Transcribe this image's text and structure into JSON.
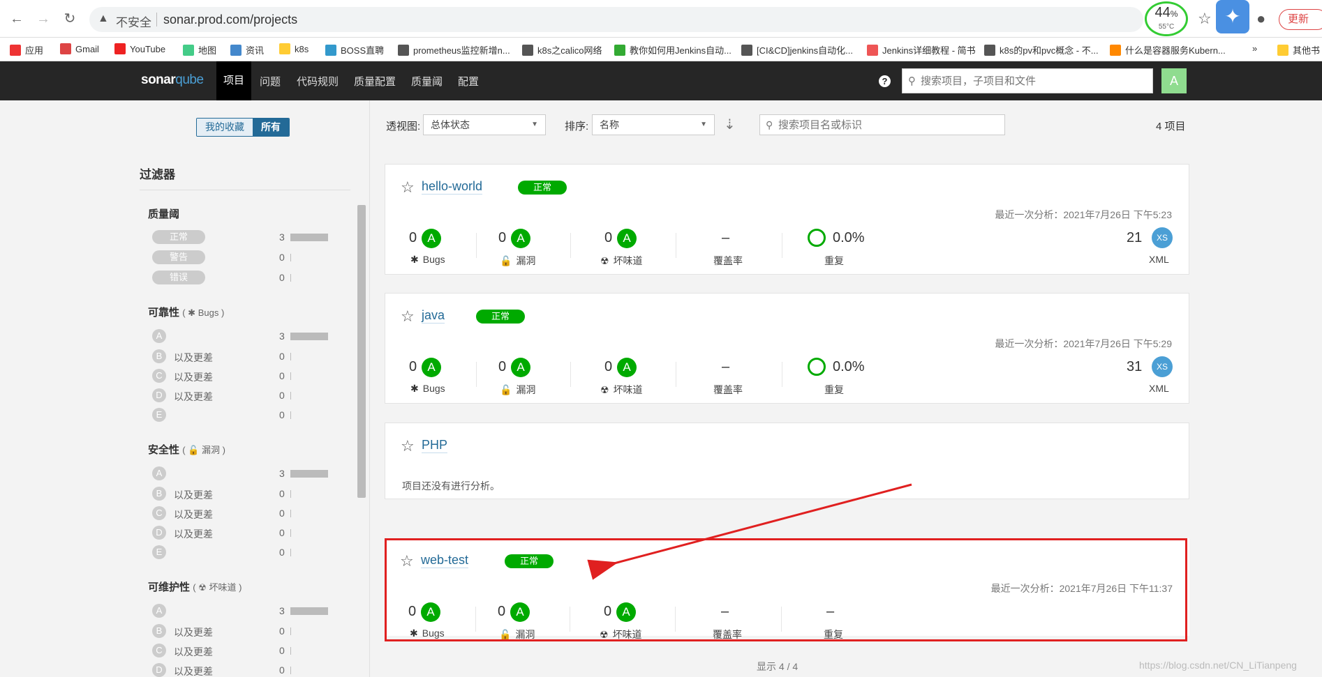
{
  "browser": {
    "insecure_label": "不安全",
    "url": "sonar.prod.com/projects",
    "battery_pct": "44",
    "battery_unit": "%",
    "battery_temp": "55°C",
    "update_label": "更新",
    "bookmarks": [
      "应用",
      "Gmail",
      "YouTube",
      "地图",
      "资讯",
      "k8s",
      "BOSS直聘",
      "prometheus监控新增n...",
      "k8s之calico网络",
      "教你如何用Jenkins自动...",
      "[CI&CD]jenkins自动化...",
      "Jenkins详细教程 - 简书",
      "k8s的pv和pvc概念 - 不...",
      "什么是容器服务Kubern...",
      "»",
      "其他书"
    ]
  },
  "nav": {
    "logo_a": "sonar",
    "logo_b": "qube",
    "items": [
      "项目",
      "问题",
      "代码规则",
      "质量配置",
      "质量阈",
      "配置"
    ],
    "help": "?",
    "search_placeholder": "搜索项目，子项目和文件",
    "avatar": "A"
  },
  "sidebar": {
    "toggle": [
      "我的收藏",
      "所有"
    ],
    "filters_title": "过滤器",
    "quality_gate": {
      "title": "质量阈",
      "options": [
        {
          "label": "正常",
          "count": "3"
        },
        {
          "label": "警告",
          "count": "0"
        },
        {
          "label": "错误",
          "count": "0"
        }
      ]
    },
    "reliability": {
      "title": "可靠性",
      "paren_open": "(",
      "sub": "Bugs",
      "paren_close": ")"
    },
    "security": {
      "title": "安全性",
      "paren_open": "(",
      "sub": "漏洞",
      "paren_close": ")"
    },
    "maintainability": {
      "title": "可维护性",
      "paren_open": "(",
      "sub": "坏味道",
      "paren_close": ")"
    },
    "grades": [
      "A",
      "B",
      "C",
      "D",
      "E"
    ],
    "worse_label": "以及更差",
    "counts": [
      "3",
      "0",
      "0",
      "0",
      "0"
    ]
  },
  "toolbar": {
    "perspective_label": "透视图:",
    "perspective_value": "总体状态",
    "sort_label": "排序:",
    "sort_value": "名称",
    "search_placeholder": "搜索项目名或标识",
    "count": "4 项目"
  },
  "projects": [
    {
      "name": "hello-world",
      "gate": "正常",
      "last_analysis": "最近一次分析：2021年7月26日 下午5:23",
      "bugs": "0",
      "bugs_rating": "A",
      "vuln": "0",
      "vuln_rating": "A",
      "smells": "0",
      "smells_rating": "A",
      "coverage": "–",
      "dup": "0.0%",
      "size": "21",
      "size_badge": "XS",
      "lang": "XML"
    },
    {
      "name": "java",
      "gate": "正常",
      "last_analysis": "最近一次分析：2021年7月26日 下午5:29",
      "bugs": "0",
      "bugs_rating": "A",
      "vuln": "0",
      "vuln_rating": "A",
      "smells": "0",
      "smells_rating": "A",
      "coverage": "–",
      "dup": "0.0%",
      "size": "31",
      "size_badge": "XS",
      "lang": "XML"
    },
    {
      "name": "PHP",
      "no_analysis": "项目还没有进行分析。"
    },
    {
      "name": "web-test",
      "gate": "正常",
      "last_analysis": "最近一次分析：2021年7月26日 下午11:37",
      "bugs": "0",
      "bugs_rating": "A",
      "vuln": "0",
      "vuln_rating": "A",
      "smells": "0",
      "smells_rating": "A",
      "coverage": "–",
      "dup": "–"
    }
  ],
  "metric_labels": {
    "bugs": "Bugs",
    "vuln": "漏洞",
    "smells": "坏味道",
    "coverage": "覆盖率",
    "dup": "重复"
  },
  "footer": "显示 4 / 4",
  "watermark": "https://blog.csdn.net/CN_LiTianpeng",
  "colors": {
    "passed": "#00aa00",
    "highlight": "#e02020",
    "link": "#236a97"
  }
}
